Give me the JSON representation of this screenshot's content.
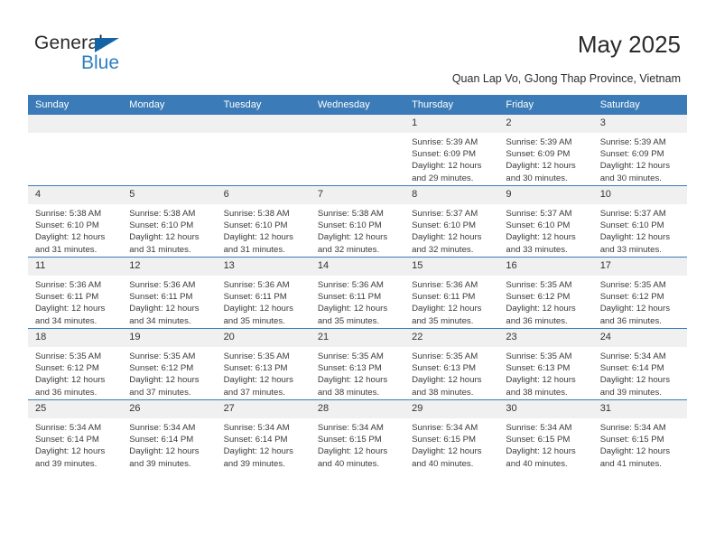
{
  "brand": {
    "name_dark": "General",
    "name_blue": "Blue",
    "accent_blue": "#2e7fc1",
    "triangle_blue": "#1464a5"
  },
  "header": {
    "title": "May 2025",
    "subtitle": "Quan Lap Vo, GJong Thap Province, Vietnam"
  },
  "calendar": {
    "header_bg": "#3b7cb8",
    "daynum_bg": "#f0f0f0",
    "weekdays": [
      "Sunday",
      "Monday",
      "Tuesday",
      "Wednesday",
      "Thursday",
      "Friday",
      "Saturday"
    ],
    "weeks": [
      [
        {
          "day": "",
          "sunrise": "",
          "sunset": "",
          "daylight1": "",
          "daylight2": ""
        },
        {
          "day": "",
          "sunrise": "",
          "sunset": "",
          "daylight1": "",
          "daylight2": ""
        },
        {
          "day": "",
          "sunrise": "",
          "sunset": "",
          "daylight1": "",
          "daylight2": ""
        },
        {
          "day": "",
          "sunrise": "",
          "sunset": "",
          "daylight1": "",
          "daylight2": ""
        },
        {
          "day": "1",
          "sunrise": "Sunrise: 5:39 AM",
          "sunset": "Sunset: 6:09 PM",
          "daylight1": "Daylight: 12 hours",
          "daylight2": "and 29 minutes."
        },
        {
          "day": "2",
          "sunrise": "Sunrise: 5:39 AM",
          "sunset": "Sunset: 6:09 PM",
          "daylight1": "Daylight: 12 hours",
          "daylight2": "and 30 minutes."
        },
        {
          "day": "3",
          "sunrise": "Sunrise: 5:39 AM",
          "sunset": "Sunset: 6:09 PM",
          "daylight1": "Daylight: 12 hours",
          "daylight2": "and 30 minutes."
        }
      ],
      [
        {
          "day": "4",
          "sunrise": "Sunrise: 5:38 AM",
          "sunset": "Sunset: 6:10 PM",
          "daylight1": "Daylight: 12 hours",
          "daylight2": "and 31 minutes."
        },
        {
          "day": "5",
          "sunrise": "Sunrise: 5:38 AM",
          "sunset": "Sunset: 6:10 PM",
          "daylight1": "Daylight: 12 hours",
          "daylight2": "and 31 minutes."
        },
        {
          "day": "6",
          "sunrise": "Sunrise: 5:38 AM",
          "sunset": "Sunset: 6:10 PM",
          "daylight1": "Daylight: 12 hours",
          "daylight2": "and 31 minutes."
        },
        {
          "day": "7",
          "sunrise": "Sunrise: 5:38 AM",
          "sunset": "Sunset: 6:10 PM",
          "daylight1": "Daylight: 12 hours",
          "daylight2": "and 32 minutes."
        },
        {
          "day": "8",
          "sunrise": "Sunrise: 5:37 AM",
          "sunset": "Sunset: 6:10 PM",
          "daylight1": "Daylight: 12 hours",
          "daylight2": "and 32 minutes."
        },
        {
          "day": "9",
          "sunrise": "Sunrise: 5:37 AM",
          "sunset": "Sunset: 6:10 PM",
          "daylight1": "Daylight: 12 hours",
          "daylight2": "and 33 minutes."
        },
        {
          "day": "10",
          "sunrise": "Sunrise: 5:37 AM",
          "sunset": "Sunset: 6:10 PM",
          "daylight1": "Daylight: 12 hours",
          "daylight2": "and 33 minutes."
        }
      ],
      [
        {
          "day": "11",
          "sunrise": "Sunrise: 5:36 AM",
          "sunset": "Sunset: 6:11 PM",
          "daylight1": "Daylight: 12 hours",
          "daylight2": "and 34 minutes."
        },
        {
          "day": "12",
          "sunrise": "Sunrise: 5:36 AM",
          "sunset": "Sunset: 6:11 PM",
          "daylight1": "Daylight: 12 hours",
          "daylight2": "and 34 minutes."
        },
        {
          "day": "13",
          "sunrise": "Sunrise: 5:36 AM",
          "sunset": "Sunset: 6:11 PM",
          "daylight1": "Daylight: 12 hours",
          "daylight2": "and 35 minutes."
        },
        {
          "day": "14",
          "sunrise": "Sunrise: 5:36 AM",
          "sunset": "Sunset: 6:11 PM",
          "daylight1": "Daylight: 12 hours",
          "daylight2": "and 35 minutes."
        },
        {
          "day": "15",
          "sunrise": "Sunrise: 5:36 AM",
          "sunset": "Sunset: 6:11 PM",
          "daylight1": "Daylight: 12 hours",
          "daylight2": "and 35 minutes."
        },
        {
          "day": "16",
          "sunrise": "Sunrise: 5:35 AM",
          "sunset": "Sunset: 6:12 PM",
          "daylight1": "Daylight: 12 hours",
          "daylight2": "and 36 minutes."
        },
        {
          "day": "17",
          "sunrise": "Sunrise: 5:35 AM",
          "sunset": "Sunset: 6:12 PM",
          "daylight1": "Daylight: 12 hours",
          "daylight2": "and 36 minutes."
        }
      ],
      [
        {
          "day": "18",
          "sunrise": "Sunrise: 5:35 AM",
          "sunset": "Sunset: 6:12 PM",
          "daylight1": "Daylight: 12 hours",
          "daylight2": "and 36 minutes."
        },
        {
          "day": "19",
          "sunrise": "Sunrise: 5:35 AM",
          "sunset": "Sunset: 6:12 PM",
          "daylight1": "Daylight: 12 hours",
          "daylight2": "and 37 minutes."
        },
        {
          "day": "20",
          "sunrise": "Sunrise: 5:35 AM",
          "sunset": "Sunset: 6:13 PM",
          "daylight1": "Daylight: 12 hours",
          "daylight2": "and 37 minutes."
        },
        {
          "day": "21",
          "sunrise": "Sunrise: 5:35 AM",
          "sunset": "Sunset: 6:13 PM",
          "daylight1": "Daylight: 12 hours",
          "daylight2": "and 38 minutes."
        },
        {
          "day": "22",
          "sunrise": "Sunrise: 5:35 AM",
          "sunset": "Sunset: 6:13 PM",
          "daylight1": "Daylight: 12 hours",
          "daylight2": "and 38 minutes."
        },
        {
          "day": "23",
          "sunrise": "Sunrise: 5:35 AM",
          "sunset": "Sunset: 6:13 PM",
          "daylight1": "Daylight: 12 hours",
          "daylight2": "and 38 minutes."
        },
        {
          "day": "24",
          "sunrise": "Sunrise: 5:34 AM",
          "sunset": "Sunset: 6:14 PM",
          "daylight1": "Daylight: 12 hours",
          "daylight2": "and 39 minutes."
        }
      ],
      [
        {
          "day": "25",
          "sunrise": "Sunrise: 5:34 AM",
          "sunset": "Sunset: 6:14 PM",
          "daylight1": "Daylight: 12 hours",
          "daylight2": "and 39 minutes."
        },
        {
          "day": "26",
          "sunrise": "Sunrise: 5:34 AM",
          "sunset": "Sunset: 6:14 PM",
          "daylight1": "Daylight: 12 hours",
          "daylight2": "and 39 minutes."
        },
        {
          "day": "27",
          "sunrise": "Sunrise: 5:34 AM",
          "sunset": "Sunset: 6:14 PM",
          "daylight1": "Daylight: 12 hours",
          "daylight2": "and 39 minutes."
        },
        {
          "day": "28",
          "sunrise": "Sunrise: 5:34 AM",
          "sunset": "Sunset: 6:15 PM",
          "daylight1": "Daylight: 12 hours",
          "daylight2": "and 40 minutes."
        },
        {
          "day": "29",
          "sunrise": "Sunrise: 5:34 AM",
          "sunset": "Sunset: 6:15 PM",
          "daylight1": "Daylight: 12 hours",
          "daylight2": "and 40 minutes."
        },
        {
          "day": "30",
          "sunrise": "Sunrise: 5:34 AM",
          "sunset": "Sunset: 6:15 PM",
          "daylight1": "Daylight: 12 hours",
          "daylight2": "and 40 minutes."
        },
        {
          "day": "31",
          "sunrise": "Sunrise: 5:34 AM",
          "sunset": "Sunset: 6:15 PM",
          "daylight1": "Daylight: 12 hours",
          "daylight2": "and 41 minutes."
        }
      ]
    ]
  }
}
